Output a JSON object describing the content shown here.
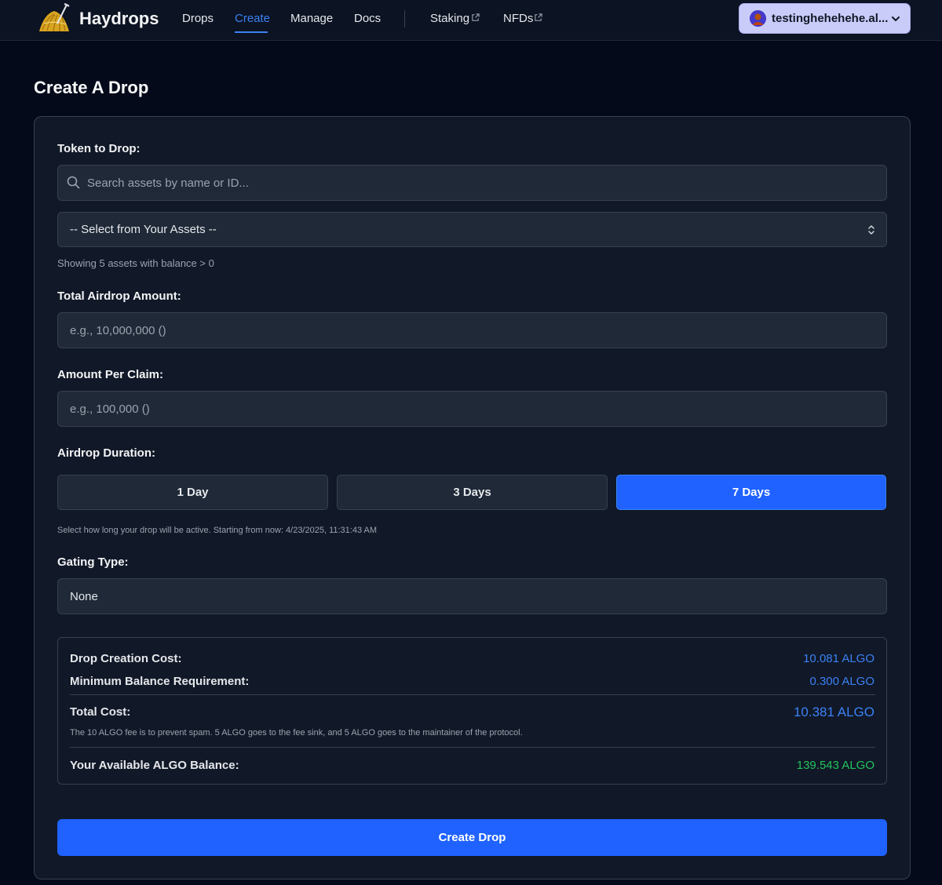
{
  "app": {
    "brand": "Haydrops"
  },
  "nav": {
    "links": [
      {
        "label": "Drops"
      },
      {
        "label": "Create"
      },
      {
        "label": "Manage"
      },
      {
        "label": "Docs"
      }
    ],
    "external_links": [
      {
        "label": "Staking",
        "icon": "external-link-icon"
      },
      {
        "label": "NFDs",
        "icon": "external-link-icon"
      }
    ],
    "active": "Create",
    "wallet": {
      "name": "testinghehehehe.al...",
      "icon": "chevron-down-icon"
    }
  },
  "page": {
    "title": "Create A Drop"
  },
  "form": {
    "token_label": "Token to Drop:",
    "search_placeholder": "Search assets by name or ID...",
    "asset_select_value": "-- Select from Your Assets --",
    "assets_hint": "Showing 5 assets with balance > 0",
    "total_label": "Total Airdrop Amount:",
    "total_placeholder": "e.g., 10,000,000 ()",
    "per_claim_label": "Amount Per Claim:",
    "per_claim_placeholder": "e.g., 100,000 ()",
    "duration_label": "Airdrop Duration:",
    "duration_options": [
      {
        "label": "1 Day"
      },
      {
        "label": "3 Days"
      },
      {
        "label": "7 Days"
      }
    ],
    "duration_selected": "7 Days",
    "duration_hint": "Select how long your drop will be active. Starting from now: 4/23/2025, 11:31:43 AM",
    "gating_label": "Gating Type:",
    "gating_value": "None"
  },
  "costs": {
    "creation_label": "Drop Creation Cost:",
    "creation_value": "10.081 ALGO",
    "min_balance_label": "Minimum Balance Requirement:",
    "min_balance_value": "0.300 ALGO",
    "total_label": "Total Cost:",
    "total_value": "10.381 ALGO",
    "fee_note": "The 10 ALGO fee is to prevent spam. 5 ALGO goes to the fee sink, and 5 ALGO goes to the maintainer of the protocol.",
    "available_label": "Your Available ALGO Balance:",
    "available_value": "139.543 ALGO"
  },
  "actions": {
    "create_label": "Create Drop"
  },
  "colors": {
    "accent": "#1f62ff",
    "link_active": "#3b82f6",
    "balance_green": "#22c55e",
    "background": "#050a1a",
    "card": "#111827"
  }
}
